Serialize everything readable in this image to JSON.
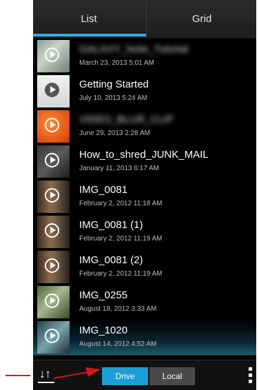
{
  "tabs": {
    "list_label": "List",
    "grid_label": "Grid"
  },
  "videos": [
    {
      "title": "GALAXY_Note_Tutorial",
      "date": "March 23, 2013 5:01 AM",
      "blurred": true,
      "thumb": "photo"
    },
    {
      "title": "Getting Started",
      "date": "July 10, 2013 5:24 AM",
      "blurred": false,
      "thumb": "drive-logo"
    },
    {
      "title": "VIDEO_BLUR_CLIP",
      "date": "June 29, 2013 2:28 AM",
      "blurred": true,
      "thumb": "orange"
    },
    {
      "title": "How_to_shred_JUNK_MAIL",
      "date": "January 11, 2013 6:17 AM",
      "blurred": false,
      "thumb": "dark"
    },
    {
      "title": "IMG_0081",
      "date": "February 2, 2012 11:18 AM",
      "blurred": false,
      "thumb": "video"
    },
    {
      "title": "IMG_0081 (1)",
      "date": "February 2, 2012 11:19 AM",
      "blurred": false,
      "thumb": "video"
    },
    {
      "title": "IMG_0081 (2)",
      "date": "February 2, 2012 11:19 AM",
      "blurred": false,
      "thumb": "video"
    },
    {
      "title": "IMG_0255",
      "date": "August 18, 2012 3:33 AM",
      "blurred": false,
      "thumb": "green"
    },
    {
      "title": "IMG_1020",
      "date": "August 14, 2012 4:52 AM",
      "blurred": false,
      "thumb": "blue"
    }
  ],
  "bottom_bar": {
    "drive_label": "Drive",
    "local_label": "Local"
  },
  "colors": {
    "accent": "#1a9ed6",
    "annotation_arrow": "#d11a1a"
  },
  "icons": [
    "play-icon",
    "sort-icon",
    "overflow-menu-icon"
  ]
}
